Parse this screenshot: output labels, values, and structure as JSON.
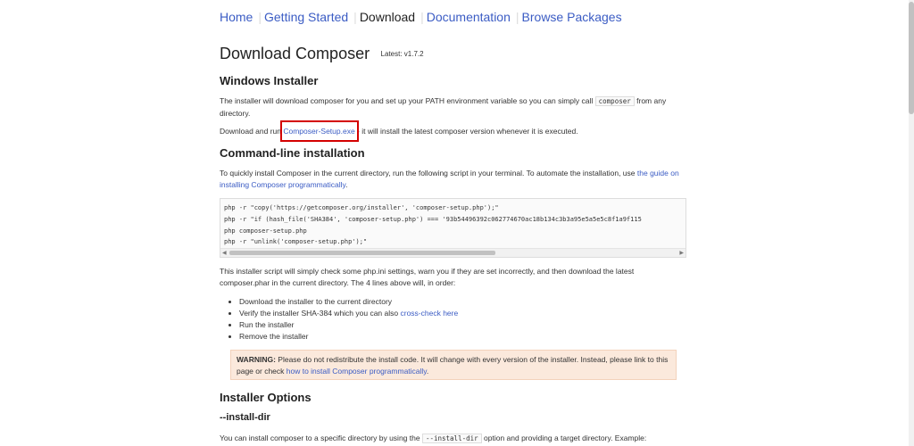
{
  "nav": {
    "home": "Home",
    "getting_started": "Getting Started",
    "download": "Download",
    "documentation": "Documentation",
    "browse_packages": "Browse Packages"
  },
  "header": {
    "title": "Download Composer",
    "latest": "Latest: v1.7.2"
  },
  "windows": {
    "heading": "Windows Installer",
    "p1_before": "The installer will download composer for you and set up your PATH environment variable so you can simply call ",
    "p1_code": "composer",
    "p1_after": " from any directory.",
    "p2_before": "Download and run ",
    "p2_link": "Composer-Setup.exe",
    "p2_after": " - it will install the latest composer version whenever it is executed."
  },
  "cli": {
    "heading": "Command-line installation",
    "p1_before": "To quickly install Composer in the current directory, run the following script in your terminal. To automate the installation, use ",
    "p1_link": "the guide on installing Composer programmatically",
    "p1_after": ".",
    "code_lines": [
      "php -r \"copy('https://getcomposer.org/installer', 'composer-setup.php');\"",
      "php -r \"if (hash_file('SHA384', 'composer-setup.php') === '93b54496392c062774670ac18b134c3b3a95e5a5e5c8f1a9f115",
      "php composer-setup.php",
      "php -r \"unlink('composer-setup.php');\""
    ],
    "p2": "This installer script will simply check some php.ini settings, warn you if they are set incorrectly, and then download the latest composer.phar in the current directory. The 4 lines above will, in order:",
    "list": {
      "item1": "Download the installer to the current directory",
      "item2_before": "Verify the installer SHA-384 which you can also ",
      "item2_link": "cross-check here",
      "item3": "Run the installer",
      "item4": "Remove the installer"
    },
    "warning_label": "WARNING:",
    "warning_text": " Please do not redistribute the install code. It will change with every version of the installer. Instead, please link to this page or check ",
    "warning_link": "how to install Composer programmatically",
    "warning_end": "."
  },
  "options": {
    "heading": "Installer Options",
    "install_dir": "--install-dir",
    "p_before": "You can install composer to a specific directory by using the ",
    "p_code": "--install-dir",
    "p_after": " option and providing a target directory. Example:"
  },
  "colors": {
    "link": "#3b5cc4",
    "highlight_box": "#d40000",
    "warning_bg": "#fbe9dc"
  }
}
